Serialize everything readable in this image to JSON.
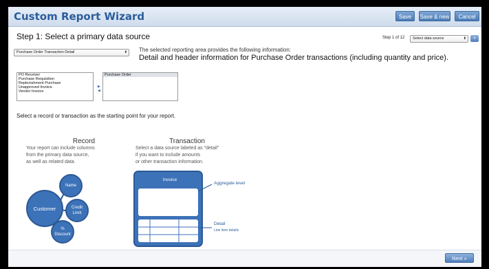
{
  "header": {
    "title": "Custom Report Wizard",
    "save": "Save",
    "save_new": "Save & new",
    "cancel": "Cancel"
  },
  "step": {
    "title": "Step 1: Select a primary data source",
    "counter": "Step 1 of 12",
    "data_source_select": "Select data source",
    "go": "»"
  },
  "source": {
    "selected": "Purchase Order Transaction Detail",
    "info_label": "The selected reporting area provides the following information:",
    "info_detail": "Detail and header information for Purchase Order transactions (including quantity and price)."
  },
  "lists": {
    "available": [
      "PO Receiver",
      "Purchase Requisition",
      "Replenishment Purchase",
      "Unapproved Invoice",
      "Vendor Invoice"
    ],
    "selected": [
      "Purchase Order"
    ],
    "move_right": "▶",
    "move_left": "◀"
  },
  "instruction": "Select a record or transaction as the starting point for your report.",
  "record": {
    "heading": "Record",
    "desc": [
      "Your report can include columns",
      "from the primary data source,",
      "as well as related data."
    ],
    "nodes": {
      "customer": "Customer",
      "name": "Name",
      "credit_limit": "Credit Limit",
      "discount": "% Discount"
    }
  },
  "transaction": {
    "heading": "Transaction",
    "desc": [
      "Select a data source labeled as \"detail\"",
      "if you want to include amounts",
      "or other transaction information."
    ],
    "invoice": "Invoice",
    "aggregate": "Aggregate level",
    "detail": "Detail",
    "detail_sub": "Line item details"
  },
  "footer": {
    "next": "Next »"
  },
  "colors": {
    "accent": "#2b5d9b",
    "node_fill": "#3c72b8"
  }
}
